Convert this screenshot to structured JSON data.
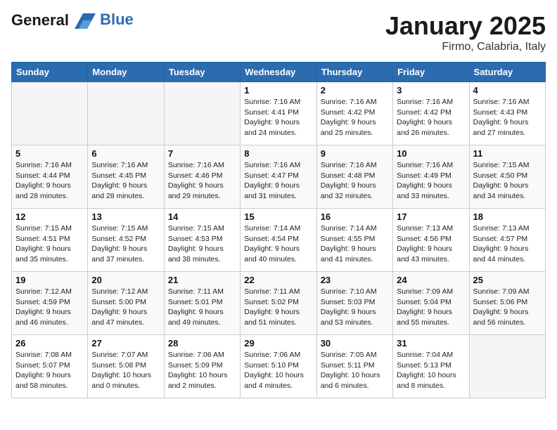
{
  "header": {
    "logo_line1": "General",
    "logo_line2": "Blue",
    "month_title": "January 2025",
    "location": "Firmo, Calabria, Italy"
  },
  "days_of_week": [
    "Sunday",
    "Monday",
    "Tuesday",
    "Wednesday",
    "Thursday",
    "Friday",
    "Saturday"
  ],
  "weeks": [
    [
      {
        "day": "",
        "info": ""
      },
      {
        "day": "",
        "info": ""
      },
      {
        "day": "",
        "info": ""
      },
      {
        "day": "1",
        "info": "Sunrise: 7:16 AM\nSunset: 4:41 PM\nDaylight: 9 hours\nand 24 minutes."
      },
      {
        "day": "2",
        "info": "Sunrise: 7:16 AM\nSunset: 4:42 PM\nDaylight: 9 hours\nand 25 minutes."
      },
      {
        "day": "3",
        "info": "Sunrise: 7:16 AM\nSunset: 4:42 PM\nDaylight: 9 hours\nand 26 minutes."
      },
      {
        "day": "4",
        "info": "Sunrise: 7:16 AM\nSunset: 4:43 PM\nDaylight: 9 hours\nand 27 minutes."
      }
    ],
    [
      {
        "day": "5",
        "info": "Sunrise: 7:16 AM\nSunset: 4:44 PM\nDaylight: 9 hours\nand 28 minutes."
      },
      {
        "day": "6",
        "info": "Sunrise: 7:16 AM\nSunset: 4:45 PM\nDaylight: 9 hours\nand 28 minutes."
      },
      {
        "day": "7",
        "info": "Sunrise: 7:16 AM\nSunset: 4:46 PM\nDaylight: 9 hours\nand 29 minutes."
      },
      {
        "day": "8",
        "info": "Sunrise: 7:16 AM\nSunset: 4:47 PM\nDaylight: 9 hours\nand 31 minutes."
      },
      {
        "day": "9",
        "info": "Sunrise: 7:16 AM\nSunset: 4:48 PM\nDaylight: 9 hours\nand 32 minutes."
      },
      {
        "day": "10",
        "info": "Sunrise: 7:16 AM\nSunset: 4:49 PM\nDaylight: 9 hours\nand 33 minutes."
      },
      {
        "day": "11",
        "info": "Sunrise: 7:15 AM\nSunset: 4:50 PM\nDaylight: 9 hours\nand 34 minutes."
      }
    ],
    [
      {
        "day": "12",
        "info": "Sunrise: 7:15 AM\nSunset: 4:51 PM\nDaylight: 9 hours\nand 35 minutes."
      },
      {
        "day": "13",
        "info": "Sunrise: 7:15 AM\nSunset: 4:52 PM\nDaylight: 9 hours\nand 37 minutes."
      },
      {
        "day": "14",
        "info": "Sunrise: 7:15 AM\nSunset: 4:53 PM\nDaylight: 9 hours\nand 38 minutes."
      },
      {
        "day": "15",
        "info": "Sunrise: 7:14 AM\nSunset: 4:54 PM\nDaylight: 9 hours\nand 40 minutes."
      },
      {
        "day": "16",
        "info": "Sunrise: 7:14 AM\nSunset: 4:55 PM\nDaylight: 9 hours\nand 41 minutes."
      },
      {
        "day": "17",
        "info": "Sunrise: 7:13 AM\nSunset: 4:56 PM\nDaylight: 9 hours\nand 43 minutes."
      },
      {
        "day": "18",
        "info": "Sunrise: 7:13 AM\nSunset: 4:57 PM\nDaylight: 9 hours\nand 44 minutes."
      }
    ],
    [
      {
        "day": "19",
        "info": "Sunrise: 7:12 AM\nSunset: 4:59 PM\nDaylight: 9 hours\nand 46 minutes."
      },
      {
        "day": "20",
        "info": "Sunrise: 7:12 AM\nSunset: 5:00 PM\nDaylight: 9 hours\nand 47 minutes."
      },
      {
        "day": "21",
        "info": "Sunrise: 7:11 AM\nSunset: 5:01 PM\nDaylight: 9 hours\nand 49 minutes."
      },
      {
        "day": "22",
        "info": "Sunrise: 7:11 AM\nSunset: 5:02 PM\nDaylight: 9 hours\nand 51 minutes."
      },
      {
        "day": "23",
        "info": "Sunrise: 7:10 AM\nSunset: 5:03 PM\nDaylight: 9 hours\nand 53 minutes."
      },
      {
        "day": "24",
        "info": "Sunrise: 7:09 AM\nSunset: 5:04 PM\nDaylight: 9 hours\nand 55 minutes."
      },
      {
        "day": "25",
        "info": "Sunrise: 7:09 AM\nSunset: 5:06 PM\nDaylight: 9 hours\nand 56 minutes."
      }
    ],
    [
      {
        "day": "26",
        "info": "Sunrise: 7:08 AM\nSunset: 5:07 PM\nDaylight: 9 hours\nand 58 minutes."
      },
      {
        "day": "27",
        "info": "Sunrise: 7:07 AM\nSunset: 5:08 PM\nDaylight: 10 hours\nand 0 minutes."
      },
      {
        "day": "28",
        "info": "Sunrise: 7:06 AM\nSunset: 5:09 PM\nDaylight: 10 hours\nand 2 minutes."
      },
      {
        "day": "29",
        "info": "Sunrise: 7:06 AM\nSunset: 5:10 PM\nDaylight: 10 hours\nand 4 minutes."
      },
      {
        "day": "30",
        "info": "Sunrise: 7:05 AM\nSunset: 5:11 PM\nDaylight: 10 hours\nand 6 minutes."
      },
      {
        "day": "31",
        "info": "Sunrise: 7:04 AM\nSunset: 5:13 PM\nDaylight: 10 hours\nand 8 minutes."
      },
      {
        "day": "",
        "info": ""
      }
    ]
  ]
}
